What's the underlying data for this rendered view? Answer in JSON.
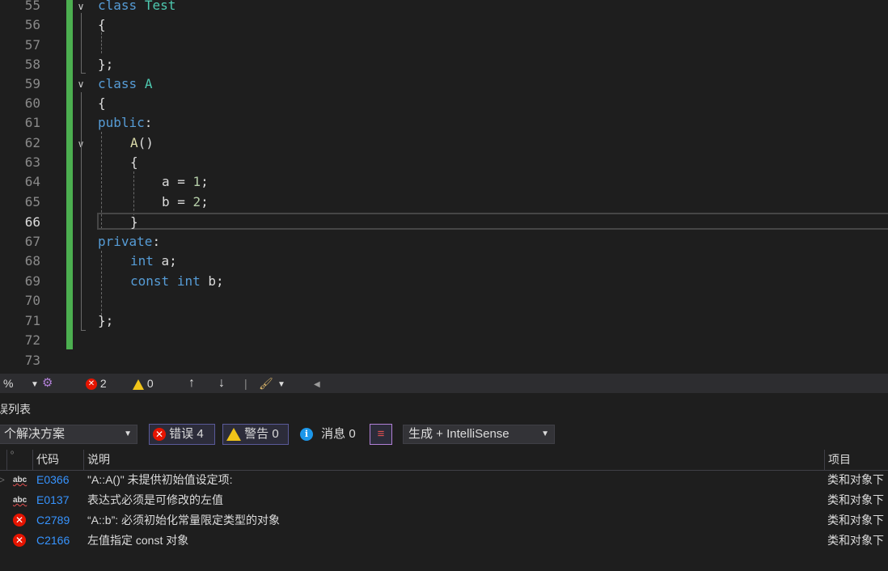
{
  "editor": {
    "line_numbers": [
      "55",
      "56",
      "57",
      "58",
      "59",
      "60",
      "61",
      "62",
      "63",
      "64",
      "65",
      "66",
      "67",
      "68",
      "69",
      "70",
      "71",
      "72",
      "73"
    ],
    "current_line": "66",
    "lines": {
      "l55_kw": "class",
      "l55_name": "Test",
      "l56": "{",
      "l58": "};",
      "l59_kw": "class",
      "l59_name": "A",
      "l60": "{",
      "l61_kw": "public",
      "l61_colon": ":",
      "l62_fn": "A",
      "l62_paren": "()",
      "l63": "{",
      "l64_var": "a = ",
      "l64_num": "1",
      "l64_end": ";",
      "l65_var": "b = ",
      "l65_num": "2",
      "l65_end": ";",
      "l66": "}",
      "l67_kw": "private",
      "l67_colon": ":",
      "l68_kw": "int",
      "l68_rest": " a;",
      "l69_kw1": "const",
      "l69_kw2": "int",
      "l69_rest": " b;",
      "l71": "};"
    }
  },
  "statusbar": {
    "zoom": "%",
    "error_count": "2",
    "warning_count": "0"
  },
  "error_list": {
    "title": "误列表",
    "scope": "个解决方案",
    "errors_filter": "错误 4",
    "warnings_filter": "警告 0",
    "messages_filter": "消息 0",
    "build_filter": "生成 + IntelliSense",
    "columns": {
      "code": "代码",
      "description": "说明",
      "project": "项目"
    },
    "rows": [
      {
        "code": "E0366",
        "description": "\"A::A()\" 未提供初始值设定项:",
        "project": "类和对象下",
        "icon": "intellisense-error-icon"
      },
      {
        "code": "E0137",
        "description": "表达式必须是可修改的左值",
        "project": "类和对象下",
        "icon": "intellisense-error-icon"
      },
      {
        "code": "C2789",
        "description": "“A::b”: 必须初始化常量限定类型的对象",
        "project": "类和对象下",
        "icon": "error-icon"
      },
      {
        "code": "C2166",
        "description": "左值指定 const 对象",
        "project": "类和对象下",
        "icon": "error-icon"
      }
    ]
  },
  "colors": {
    "accent_green": "#4caf50",
    "error_red": "#e51400",
    "link_blue": "#3794ff",
    "keyword_blue": "#569cd6",
    "type_teal": "#4ec9b0"
  }
}
